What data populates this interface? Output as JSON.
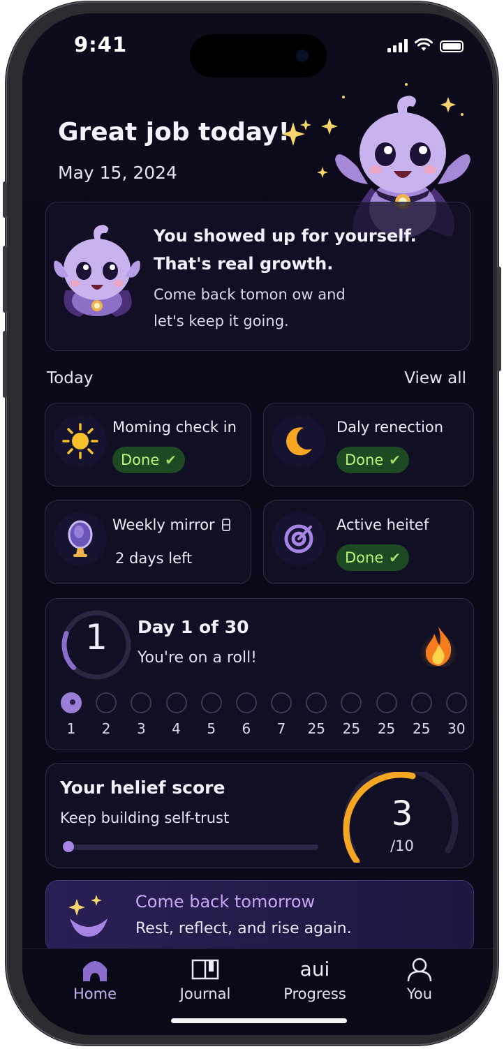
{
  "status_bar": {
    "time": "9:41",
    "icons": [
      "signal-icon",
      "wifi-icon",
      "battery-icon"
    ]
  },
  "header": {
    "title": "Great job today!",
    "title_icon": "sparkles-icon",
    "date": "May 15, 2024"
  },
  "hero_card": {
    "line1": "You showed up for yourself.",
    "line2": "That's real growth.",
    "line3": "Come back tomon ow and",
    "line4": "let's keep it going."
  },
  "today_section": {
    "title": "Today",
    "view_all": "View all"
  },
  "tasks": [
    {
      "label": "Moming check in",
      "icon": "sun-icon",
      "status": "Done"
    },
    {
      "label": "Daly renection",
      "icon": "moon-icon",
      "status": "Done"
    },
    {
      "label": "Weekly mirror",
      "icon": "mirror-icon",
      "status_text": "2 days left",
      "extra_icon": "lock-icon"
    },
    {
      "label": "Active heitef",
      "icon": "target-icon",
      "status": "Done"
    }
  ],
  "streak": {
    "current": "1",
    "title": "Day 1 of 30",
    "subtitle": "You're on a roll!",
    "progress": 0.0333,
    "days": [
      "1",
      "2",
      "3",
      "4",
      "5",
      "6",
      "7",
      "25",
      "25",
      "25",
      "25",
      "30"
    ],
    "active_index": 0
  },
  "score": {
    "title": "Your helief score",
    "subtitle": "Keep building self-trust",
    "value": "3",
    "max": "/10",
    "fraction": 0.3
  },
  "tomorrow": {
    "title": "Come back tomorrow",
    "subtitle": "Rest, reflect, and rise again."
  },
  "tabs": [
    {
      "label": "Home",
      "icon": "home-icon",
      "active": true
    },
    {
      "label": "Journal",
      "icon": "journal-icon"
    },
    {
      "label": "Progress",
      "glyph": "aui"
    },
    {
      "label": "You",
      "icon": "profile-icon"
    }
  ],
  "colors": {
    "background": "#0b0a1a",
    "accent_purple": "#9b7ed8",
    "done_green": "#bdf07b",
    "gauge_orange": "#f5a623",
    "sparkle_yellow": "#f6d56a"
  }
}
